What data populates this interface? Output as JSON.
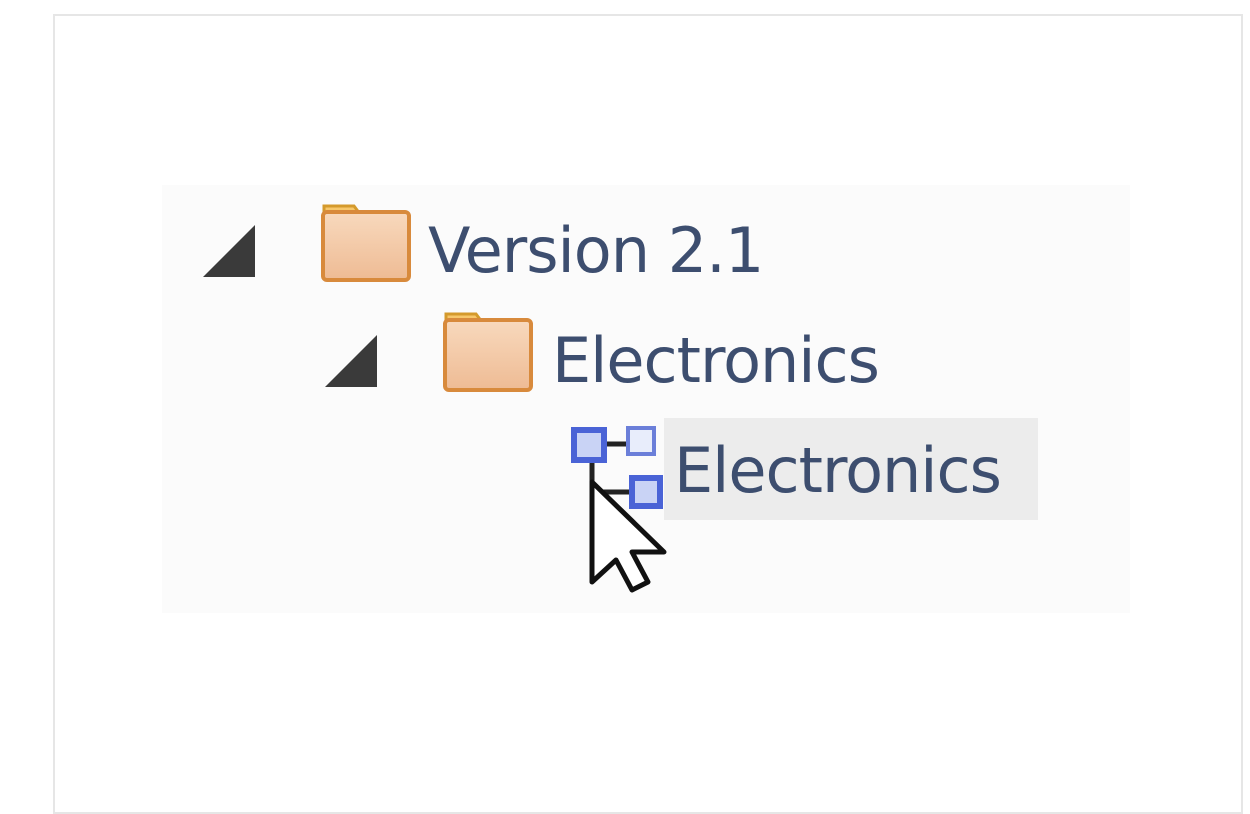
{
  "tree": {
    "root": {
      "label": "Version 2.1",
      "icon": "folder-icon",
      "expanded": true
    },
    "child": {
      "label": "Electronics",
      "icon": "folder-icon",
      "expanded": true
    },
    "leaf": {
      "label": "Electronics",
      "icon": "diagram-icon",
      "selected": true
    }
  },
  "colors": {
    "label_text": "#3d4e6f",
    "folder_fill": "#f3c9a4",
    "folder_border": "#d89a3a",
    "diagram_blue": "#4a63d6",
    "selection_bg": "#ececec",
    "expander": "#3a3a3a"
  },
  "cursor": "arrow-cursor-icon"
}
